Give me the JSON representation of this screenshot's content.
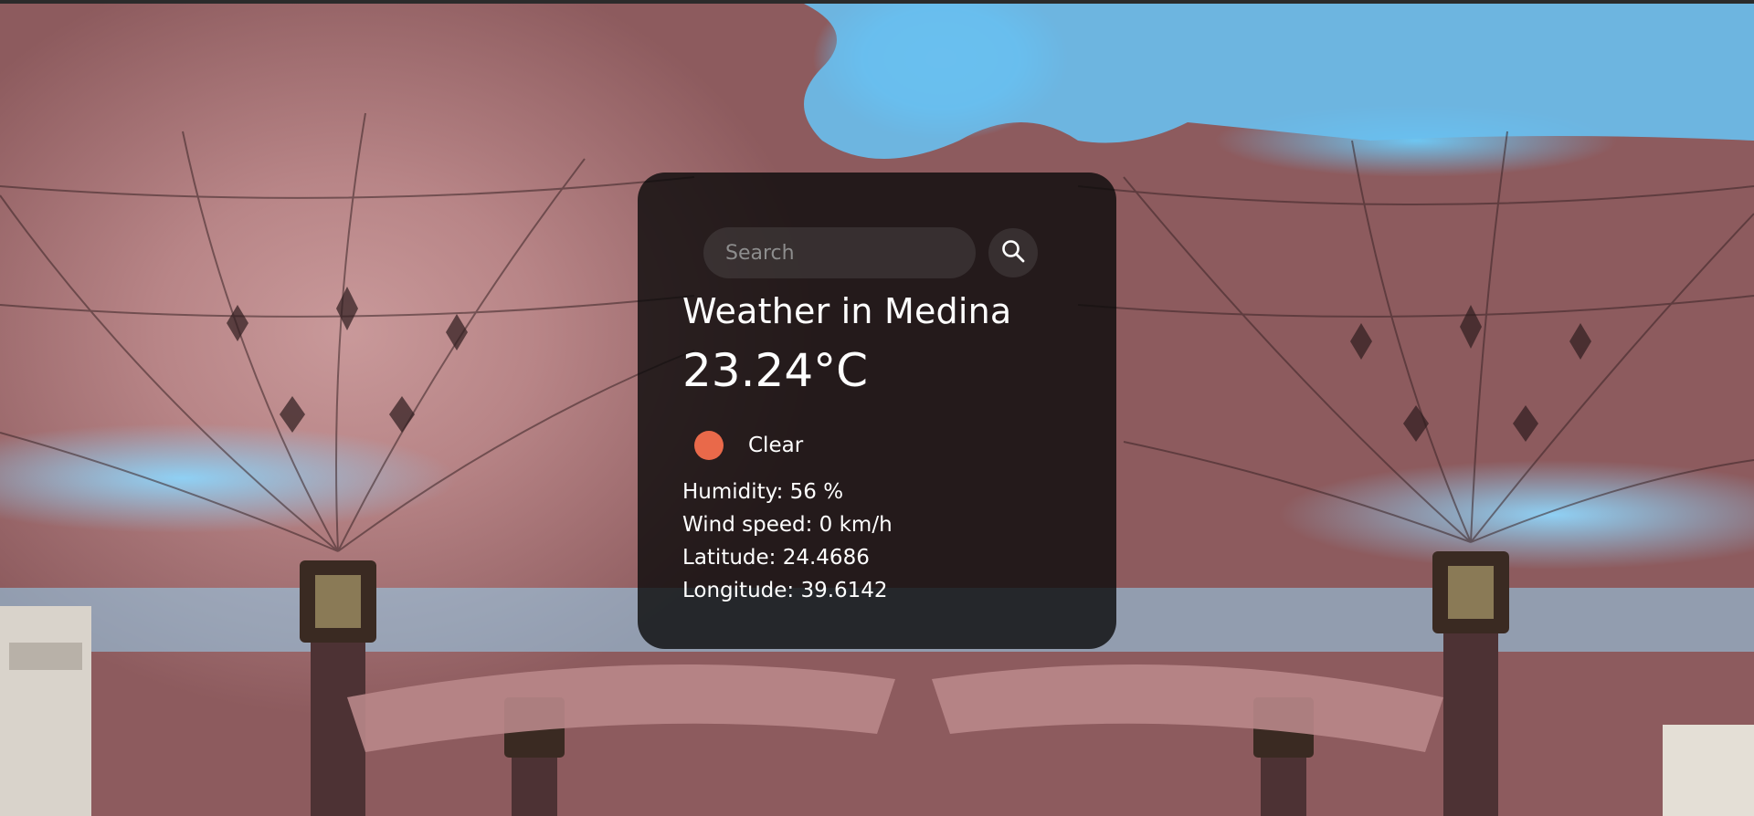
{
  "search": {
    "placeholder": "Search",
    "value": "",
    "button_icon": "search-icon"
  },
  "weather": {
    "title": "Weather in Medina",
    "temperature": "23.24°C",
    "condition_icon": "clear-sun-icon",
    "condition_icon_color": "#e9694a",
    "condition": "Clear",
    "humidity": "Humidity: 56 %",
    "wind_speed": "Wind speed: 0 km/h",
    "latitude": "Latitude: 24.4686",
    "longitude": "Longitude: 39.6142"
  },
  "colors": {
    "card_background": "rgba(10,10,10,0.8)",
    "text": "#ffffff",
    "sky": "#6fc3ef",
    "umbrella": "#b88587"
  }
}
